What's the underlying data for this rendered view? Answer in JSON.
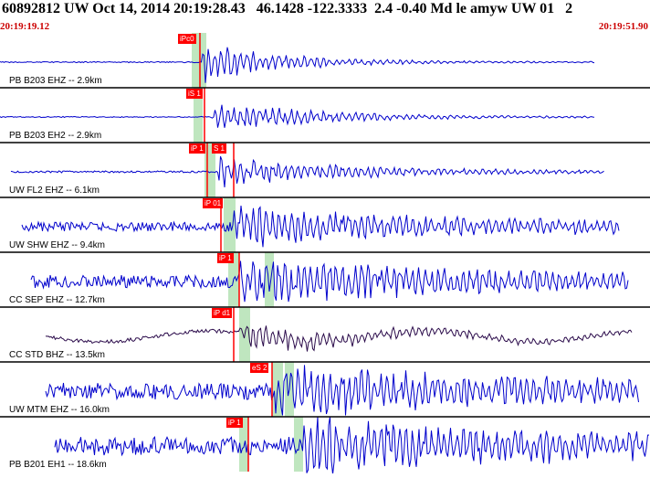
{
  "header": {
    "title": "60892812 UW Oct 14, 2014 20:19:28.43   46.1428 -122.3333  2.4 -0.40 Md le amyw UW 01   2",
    "start_time": "20:19:19.12",
    "end_time": "20:19:51.90"
  },
  "colors": {
    "trace_blue": "#0000cc",
    "trace_dark": "#2a0a4a",
    "pick_red": "#ff0000",
    "phase_window_green": "#bfe6bf",
    "divider": "#000000"
  },
  "traces": [
    {
      "label": "PB B203 EHZ -- 2.9km",
      "picks": [
        "iPc0"
      ],
      "color": "blue"
    },
    {
      "label": "PB B203 EH2 -- 2.9km",
      "picks": [
        "iS 1"
      ],
      "color": "blue"
    },
    {
      "label": "UW FL2 EHZ -- 6.1km",
      "picks": [
        "iP 1",
        "S 1"
      ],
      "color": "blue"
    },
    {
      "label": "UW SHW EHZ -- 9.4km",
      "picks": [
        "iP 01"
      ],
      "color": "blue"
    },
    {
      "label": "CC SEP EHZ -- 12.7km",
      "picks": [
        "iP 1"
      ],
      "color": "blue"
    },
    {
      "label": "CC STD BHZ -- 13.5km",
      "picks": [
        "iP d1"
      ],
      "color": "dark"
    },
    {
      "label": "UW MTM EHZ -- 16.0km",
      "picks": [
        "eS 2"
      ],
      "color": "blue"
    },
    {
      "label": "PB B201 EH1 -- 18.6km",
      "picks": [
        "iP 1"
      ],
      "color": "blue"
    }
  ]
}
